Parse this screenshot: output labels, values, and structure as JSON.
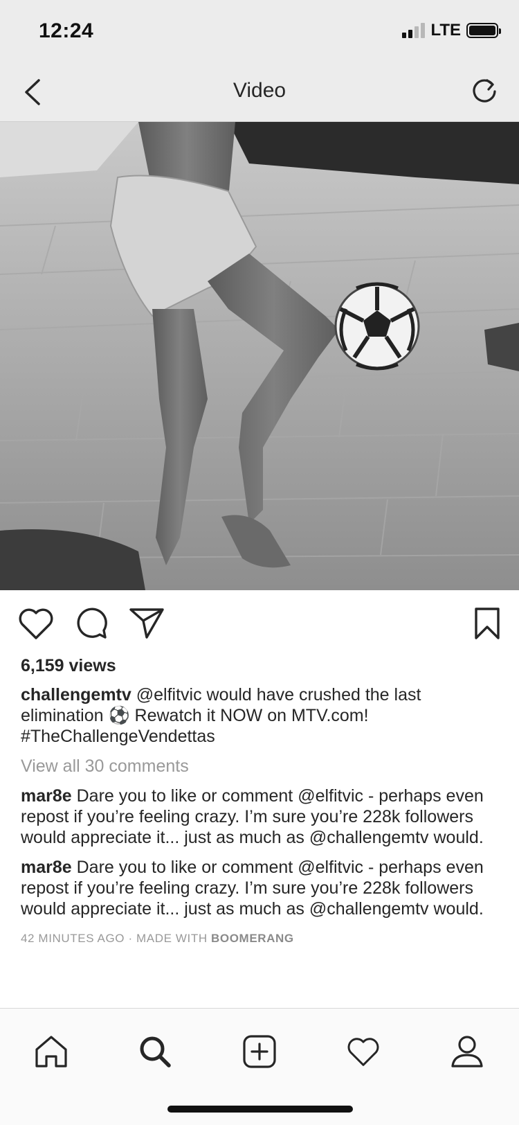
{
  "status_bar": {
    "time": "12:24",
    "network": "LTE",
    "signal_bars_active": 2,
    "signal_bars_total": 4,
    "battery_level": 0.85
  },
  "nav": {
    "title": "Video",
    "back_icon": "chevron-left-icon",
    "refresh_icon": "refresh-icon"
  },
  "post": {
    "views": "6,159 views",
    "caption_user": "challengemtv",
    "caption_text": "@elfitvic would have crushed the last elimination ⚽️ Rewatch it NOW on MTV.com! #TheChallengeVendettas",
    "view_all_comments": "View all 30 comments",
    "comments": [
      {
        "user": "mar8e",
        "text": "Dare you to like or comment @elfitvic - perhaps even repost if you’re feeling crazy. I’m sure you’re 228k followers would appreciate it... just as much as @challengemtv would."
      },
      {
        "user": "mar8e",
        "text": "Dare you to like or comment @elfitvic - perhaps even repost if you’re feeling crazy. I’m sure you’re 228k followers would appreciate it... just as much as @challengemtv would."
      }
    ],
    "timestamp": "42 MINUTES AGO",
    "made_with_prefix": "MADE WITH",
    "made_with_app": "BOOMERANG"
  },
  "actions": {
    "like_icon": "heart-icon",
    "comment_icon": "comment-icon",
    "share_icon": "send-icon",
    "save_icon": "bookmark-icon"
  },
  "tab_bar": {
    "items": [
      "home-icon",
      "search-icon",
      "add-post-icon",
      "activity-heart-icon",
      "profile-icon"
    ]
  },
  "colors": {
    "text": "#262626",
    "muted": "#999999",
    "bar_bg": "#ececec",
    "tab_bg": "#fafafa"
  }
}
